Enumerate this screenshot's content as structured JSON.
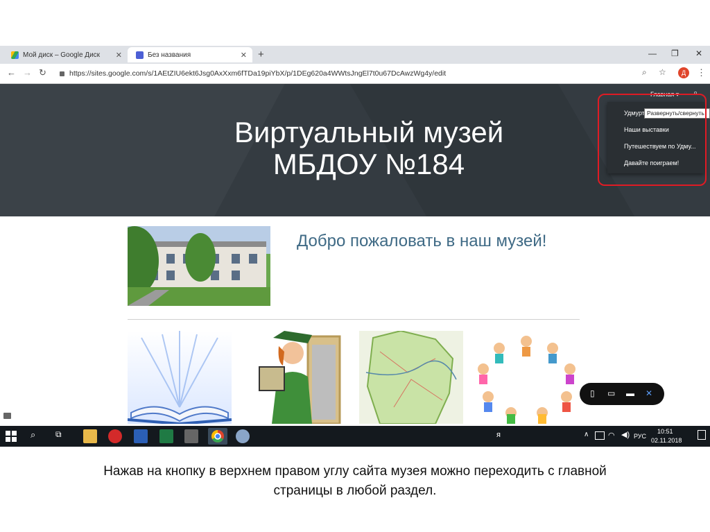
{
  "browser": {
    "tabs": [
      {
        "label": "Мой диск – Google Диск"
      },
      {
        "label": "Без названия"
      }
    ],
    "url": "https://sites.google.com/s/1AEtZIU6ekt6Jsg0AxXxm6fTDa19piYbX/p/1DEg620a4WWtsJngEl7t0u67DcAwzWg4y/edit",
    "profile_initial": "Д"
  },
  "site": {
    "title_line1": "Виртуальный музей",
    "title_line2": "МБДОУ №184",
    "home_link": "Главная",
    "menu_items": [
      "Удмурт",
      "Наши выставки",
      "Путешествуем по Удму...",
      "Давайте поиграем!"
    ],
    "tooltip": "Развернуть/свернуть",
    "welcome": "Добро пожаловать в наш музей!"
  },
  "taskbar": {
    "language": "РУС",
    "time": "10:51",
    "date": "02.11.2018"
  },
  "caption": {
    "line1": "Нажав на кнопку в верхнем правом углу сайта музея можно переходить с главной",
    "line2": "страницы в любой раздел."
  },
  "colors": {
    "hero_bg": "#343b41",
    "highlight": "#e01b24",
    "welcome_text": "#3f6a85",
    "taskbar_bg": "#14191e"
  }
}
